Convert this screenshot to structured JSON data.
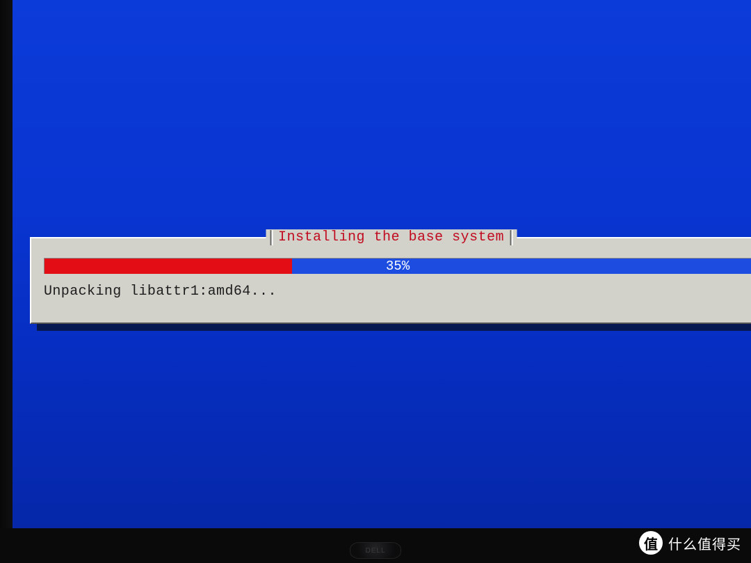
{
  "installer": {
    "title": "Installing the base system",
    "progress_percent": 35,
    "progress_label": "35%",
    "status": "Unpacking libattr1:amd64..."
  },
  "monitor": {
    "brand": "DELL"
  },
  "watermark": {
    "badge": "值",
    "text": "什么值得买"
  },
  "colors": {
    "bg_blue": "#0935d0",
    "dialog_bg": "#d2d2cb",
    "title_red": "#c10b1f",
    "bar_fill": "#e20d15",
    "bar_track": "#1d4de0"
  }
}
